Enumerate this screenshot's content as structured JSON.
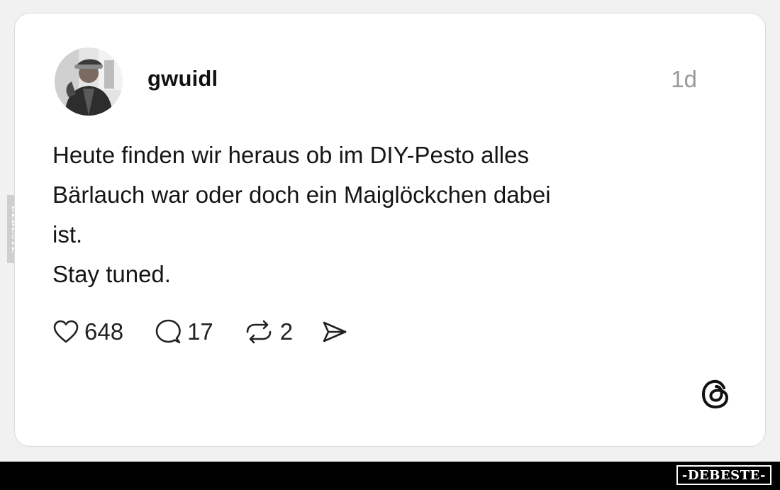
{
  "post": {
    "username": "gwuidl",
    "timestamp": "1d",
    "text_lines": [
      "Heute finden wir heraus ob im DIY-Pesto alles",
      "Bärlauch war oder doch ein Maiglöckchen dabei",
      "ist.",
      "Stay tuned."
    ],
    "actions": {
      "likes": "648",
      "replies": "17",
      "reposts": "2"
    },
    "icons": {
      "like": "heart-icon",
      "reply": "speech-bubble-icon",
      "repost": "repost-arrows-icon",
      "share": "send-icon",
      "brand": "threads-logo-icon"
    }
  },
  "watermark": {
    "side": "DEBESTE",
    "footer": "-DEBESTE-"
  },
  "colors": {
    "card_background": "#ffffff",
    "page_background": "#f1f1f1",
    "text": "#151515",
    "muted": "#9a9a9a",
    "footer_background": "#000000"
  }
}
